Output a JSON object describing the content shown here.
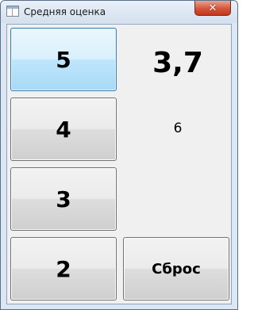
{
  "window": {
    "title": "Средняя оценка",
    "app_icon": "app-window-icon",
    "close_icon": "close-icon",
    "close_glyph": "✕"
  },
  "grades": [
    {
      "label": "5"
    },
    {
      "label": "4"
    },
    {
      "label": "3"
    },
    {
      "label": "2"
    }
  ],
  "average_value": "3,7",
  "grade_count": "6",
  "reset_label": "Сброс",
  "colors": {
    "focus_border": "#3c7fb1",
    "close_button": "#c7472c"
  }
}
